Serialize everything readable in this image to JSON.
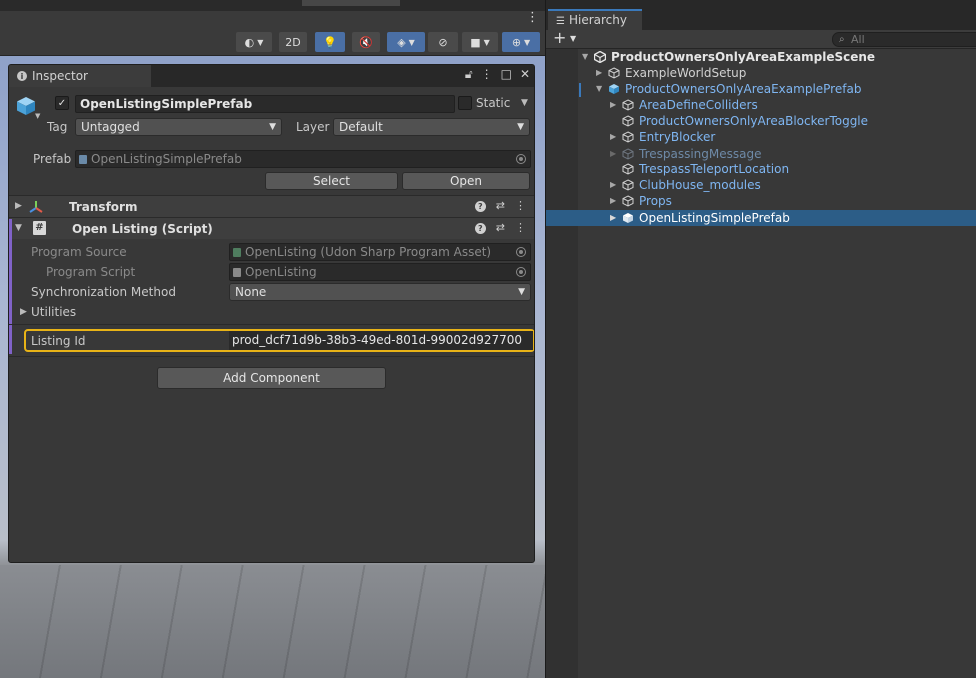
{
  "inspector": {
    "tab_title": "Inspector",
    "gameobject": {
      "name": "OpenListingSimplePrefab",
      "active_checked": "✓",
      "static_label": "Static",
      "tag_label": "Tag",
      "tag_value": "Untagged",
      "layer_label": "Layer",
      "layer_value": "Default"
    },
    "prefab": {
      "label": "Prefab",
      "value": "OpenListingSimplePrefab",
      "select_label": "Select",
      "open_label": "Open"
    },
    "components": {
      "transform_title": "Transform",
      "script_title": "Open Listing (Script)",
      "script_icon": "#"
    },
    "fields": {
      "program_source_label": "Program Source",
      "program_source_value": "OpenListing (Udon Sharp Program Asset)",
      "program_script_label": "Program Script",
      "program_script_value": "OpenListing",
      "sync_label": "Synchronization Method",
      "sync_value": "None",
      "utilities_label": "Utilities",
      "listing_id_label": "Listing Id",
      "listing_id_value": "prod_dcf71d9b-38b3-49ed-801d-99002d927700"
    },
    "add_component_label": "Add Component"
  },
  "scene_toolbar": {
    "mode_2d": "2D"
  },
  "hierarchy": {
    "tab_title": "Hierarchy",
    "search_placeholder": "All",
    "scene_name": "ProductOwnersOnlyAreaExampleScene",
    "items": [
      {
        "label": "ExampleWorldSetup",
        "depth": 1,
        "expandable": true,
        "style": "normal"
      },
      {
        "label": "ProductOwnersOnlyAreaExamplePrefab",
        "depth": 1,
        "expandable": true,
        "expanded": true,
        "style": "prefab"
      },
      {
        "label": "AreaDefineColliders",
        "depth": 2,
        "expandable": true,
        "style": "prefab"
      },
      {
        "label": "ProductOwnersOnlyAreaBlockerToggle",
        "depth": 2,
        "expandable": false,
        "style": "prefab"
      },
      {
        "label": "EntryBlocker",
        "depth": 2,
        "expandable": true,
        "style": "prefab"
      },
      {
        "label": "TrespassingMessage",
        "depth": 2,
        "expandable": true,
        "style": "dim"
      },
      {
        "label": "TrespassTeleportLocation",
        "depth": 2,
        "expandable": false,
        "style": "prefab"
      },
      {
        "label": "ClubHouse_modules",
        "depth": 2,
        "expandable": true,
        "style": "prefab"
      },
      {
        "label": "Props",
        "depth": 2,
        "expandable": true,
        "style": "prefab"
      },
      {
        "label": "OpenListingSimplePrefab",
        "depth": 2,
        "expandable": true,
        "style": "selected"
      }
    ]
  },
  "colors": {
    "selection": "#2c5d87",
    "prefab_text": "#7fb6f2",
    "highlight_outline": "#e8b317",
    "script_accent": "#8062c8"
  }
}
